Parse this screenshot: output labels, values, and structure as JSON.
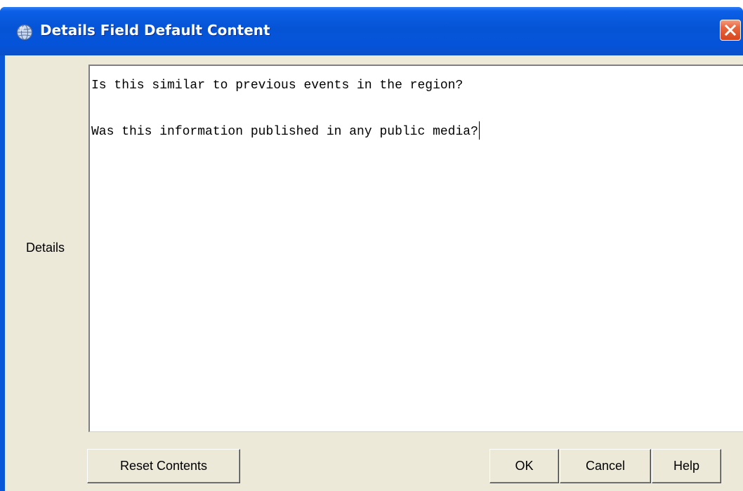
{
  "window": {
    "title": "Details Field Default Content",
    "title_icon": "globe-icon",
    "close_icon": "close-icon"
  },
  "form": {
    "details_label": "Details",
    "details_lines": [
      "Is this similar to previous events in the region?",
      "",
      "Was this information published in any public media?"
    ]
  },
  "buttons": {
    "reset_label": "Reset Contents",
    "ok_label": "OK",
    "cancel_label": "Cancel",
    "help_label": "Help"
  },
  "colors": {
    "titlebar": "#0654d6",
    "dialog_background": "#ece9d8",
    "close_button": "#e0532a",
    "text_area": "#ffffff"
  }
}
